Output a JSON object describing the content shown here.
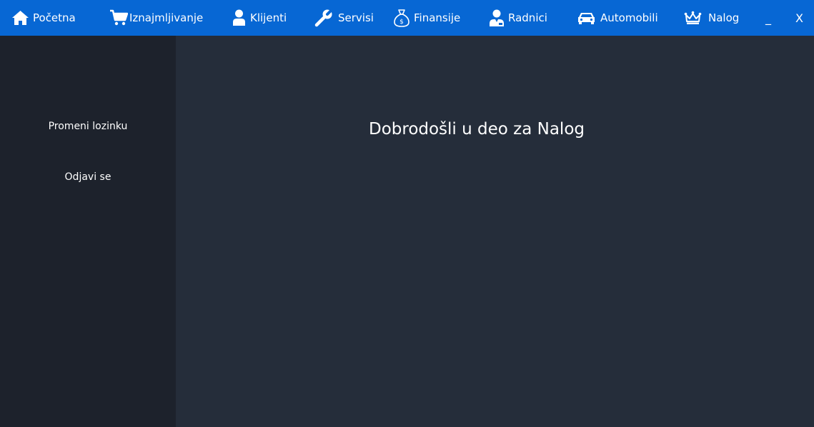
{
  "nav": {
    "items": [
      {
        "label": "Početna",
        "icon": "home-icon"
      },
      {
        "label": "Iznajmljivanje",
        "icon": "cart-icon"
      },
      {
        "label": "Klijenti",
        "icon": "user-icon"
      },
      {
        "label": "Servisi",
        "icon": "wrench-icon"
      },
      {
        "label": "Finansije",
        "icon": "money-bag-icon"
      },
      {
        "label": "Radnici",
        "icon": "worker-icon"
      },
      {
        "label": "Automobili",
        "icon": "car-icon"
      },
      {
        "label": "Nalog",
        "icon": "crown-icon"
      }
    ],
    "minimize_label": "_",
    "close_label": "X"
  },
  "sidebar": {
    "items": [
      {
        "label": "Promeni lozinku"
      },
      {
        "label": "Odjavi se"
      }
    ]
  },
  "main": {
    "welcome_text": "Dobrodošli u deo za Nalog"
  },
  "colors": {
    "topbar": "#0767d4",
    "sidebar": "#1d222c",
    "main": "#252d3a",
    "text": "#ffffff"
  }
}
